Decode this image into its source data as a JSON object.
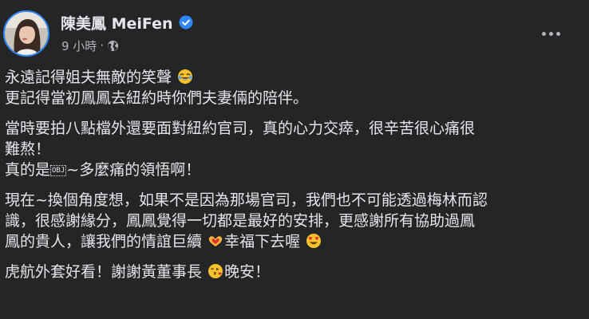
{
  "post": {
    "author": "陳美鳳 MeiFen",
    "time": "9 小時",
    "separator": "·",
    "verified_icon": "verified-badge-icon",
    "privacy_icon": "globe-icon",
    "more_icon": "more-options-icon",
    "colors": {
      "background": "#242526",
      "text": "#e4e6eb",
      "meta": "#b0b3b8",
      "verified": "#2d88ff"
    }
  },
  "content": {
    "p1": {
      "l1": "永遠記得姐夫無敵的笑聲",
      "l2": "更記得當初鳳鳳去紐約時你們夫妻倆的陪伴。"
    },
    "p2": {
      "l1": "當時要拍八點檔外還要面對紐約官司，真的心力交瘁，很辛苦很心痛很",
      "l2": "難熬！",
      "l3a": "真的是",
      "l3obj": "OBJ",
      "l3b": "~多麼痛的領悟啊！"
    },
    "p3": {
      "l1": "現在~換個角度想，如果不是因為那場官司，我們也不可能透過梅林而認",
      "l2": "識，很感謝緣分，鳳鳳覺得一切都是最好的安排，更感謝所有協助過鳳",
      "l3a": "鳳的貴人，讓我們的情誼巨續",
      "l3b": "幸福下去喔"
    },
    "p4": {
      "l1a": "虎航外套好看！謝謝黃董事長",
      "l1b": "晚安！"
    },
    "emojis": [
      "laughing-tears-emoji",
      "heart-hands-emoji",
      "heart-eyes-emoji",
      "kissing-heart-emoji"
    ]
  }
}
